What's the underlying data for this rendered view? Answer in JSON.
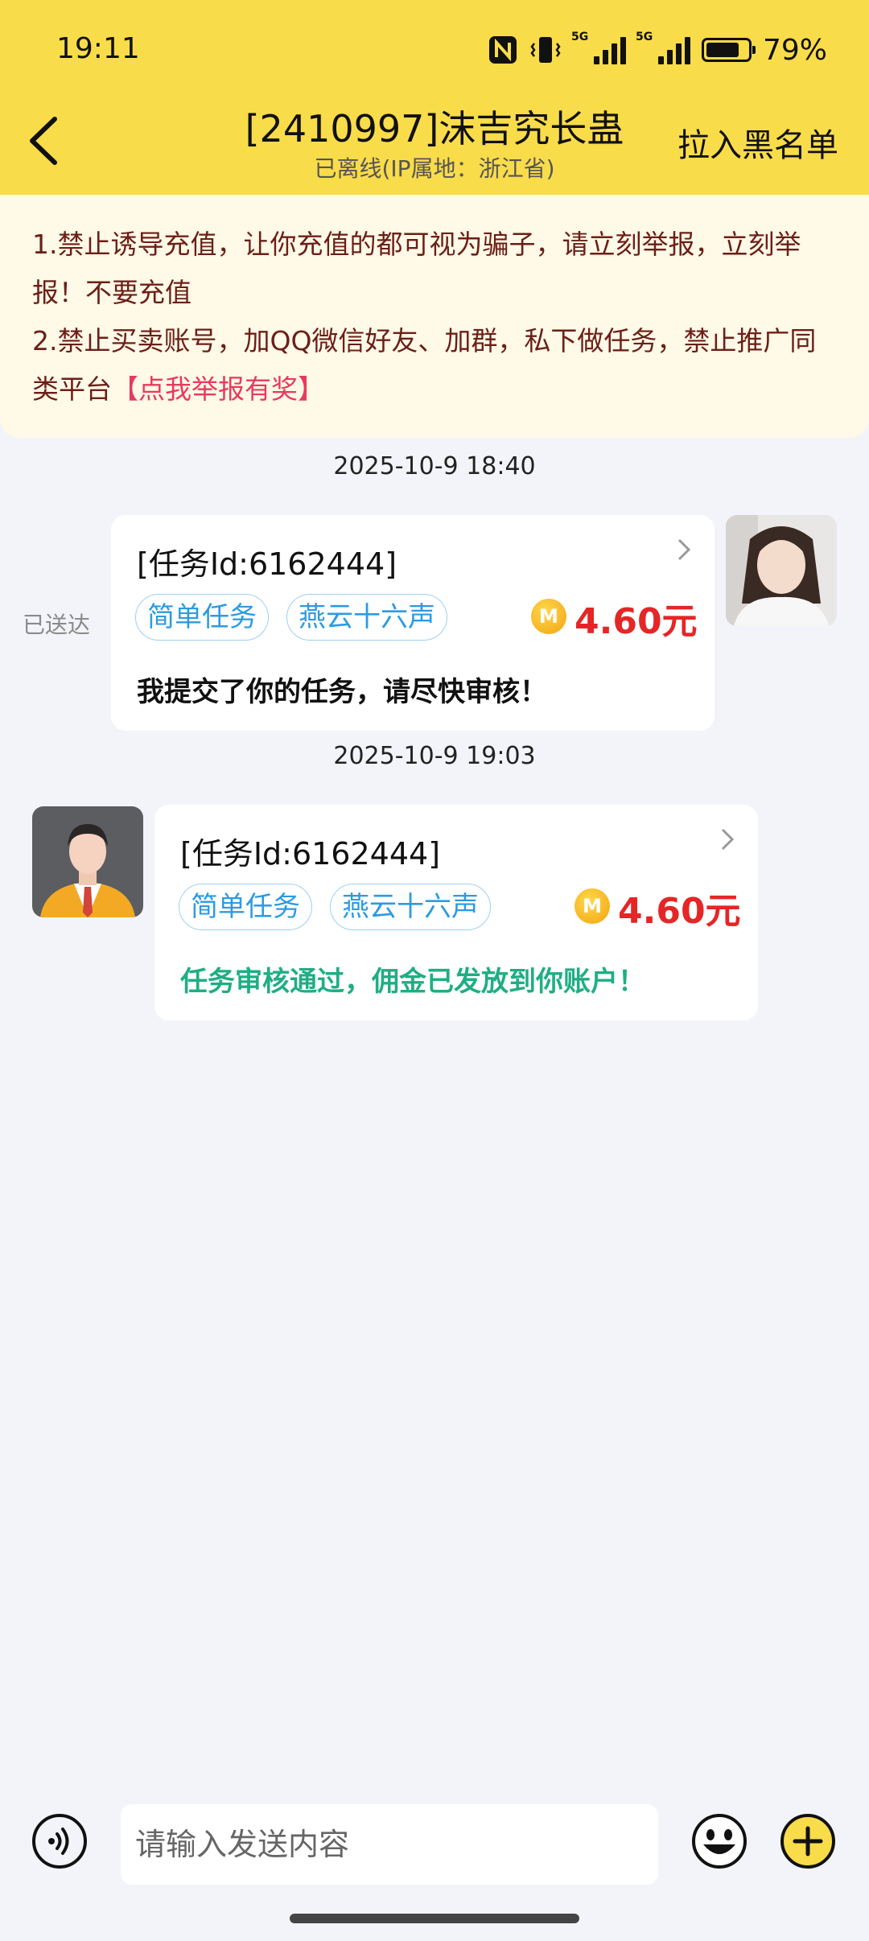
{
  "status_bar": {
    "time": "19:11",
    "network1": "5G",
    "network2": "5G",
    "battery_text": "79%",
    "battery_level": 0.79
  },
  "header": {
    "title": "[2410997]沫吉究长蛊",
    "subtitle": "已离线(IP属地：浙江省)",
    "blacklist_label": "拉入黑名单"
  },
  "notice": {
    "line1": "1.禁止诱导充值，让你充值的都可视为骗子，请立刻举报，立刻举报！不要充值",
    "line2": "2.禁止买卖账号，加QQ微信好友、加群，私下做任务，禁止推广同类平台",
    "report_link": "【点我举报有奖】"
  },
  "messages": [
    {
      "timestamp": "2025-10-9 18:40",
      "task_id": "[任务Id:6162444]",
      "tag1": "简单任务",
      "tag2": "燕云十六声",
      "coin_symbol": "M",
      "price": "4.60元",
      "text": "我提交了你的任务，请尽快审核！",
      "status": "已送达"
    },
    {
      "timestamp": "2025-10-9 19:03",
      "task_id": "[任务Id:6162444]",
      "tag1": "简单任务",
      "tag2": "燕云十六声",
      "coin_symbol": "M",
      "price": "4.60元",
      "text": "任务审核通过，佣金已发放到你账户！"
    }
  ],
  "input": {
    "placeholder": "请输入发送内容"
  },
  "colors": {
    "header_bg": "#f9dc4a",
    "notice_text": "#6b1f17",
    "report_link": "#e83a5c",
    "price": "#e52626",
    "tag": "#2c9be0",
    "approved_text": "#1fae83"
  },
  "icons": [
    "back-arrow-icon",
    "nfc-icon",
    "vibrate-icon",
    "signal-icon",
    "battery-icon",
    "chevron-right-icon",
    "coin-icon",
    "voice-icon",
    "emoji-icon",
    "plus-icon"
  ]
}
